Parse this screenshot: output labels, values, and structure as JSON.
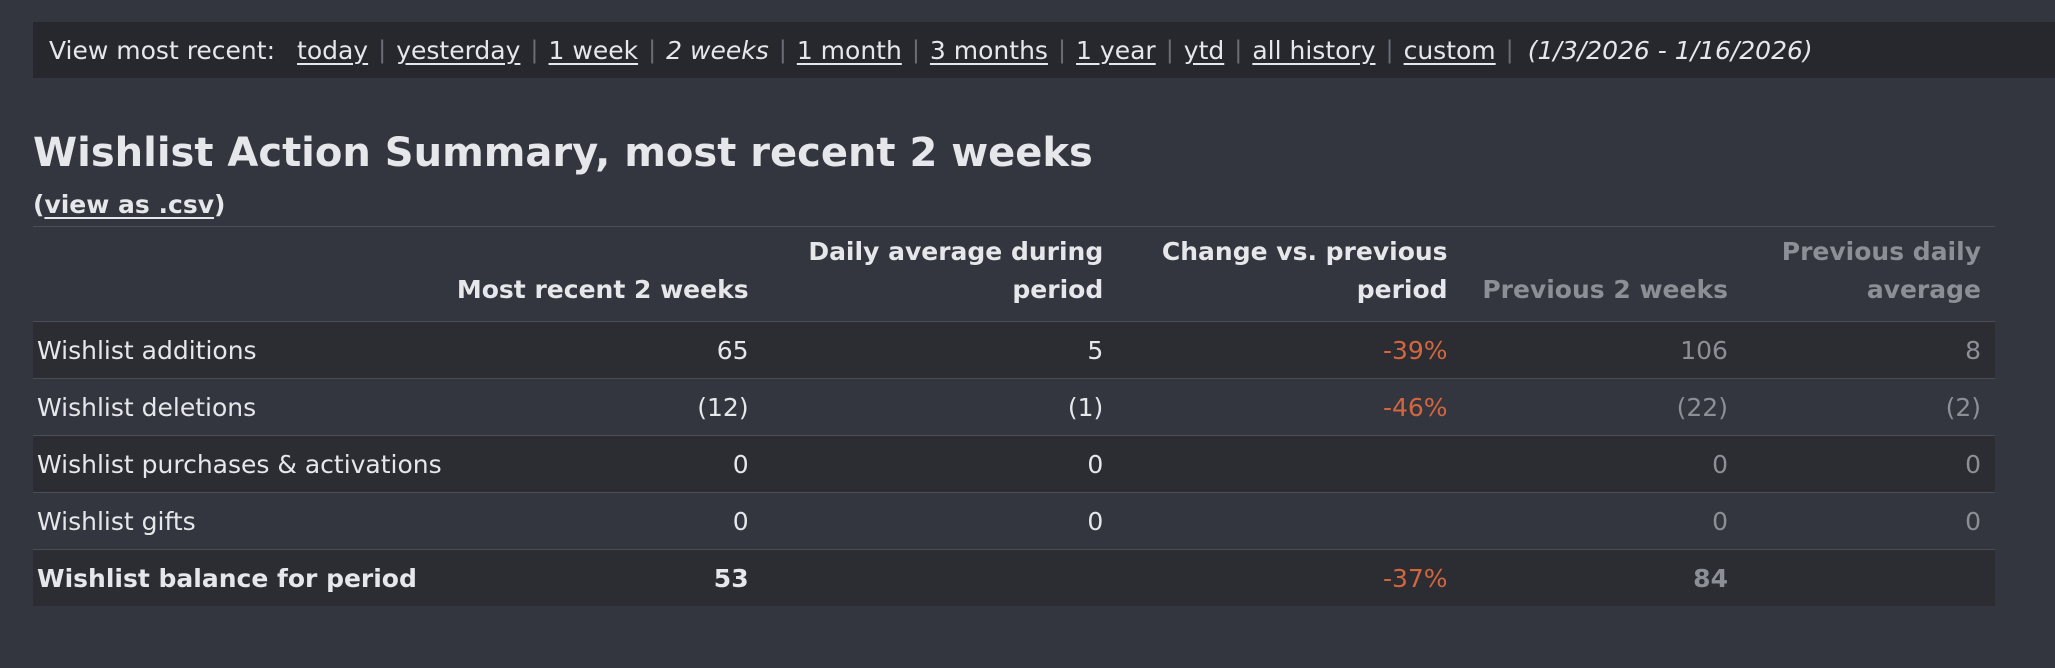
{
  "range_bar": {
    "prefix": "View most recent:",
    "options": [
      "today",
      "yesterday",
      "1 week",
      "2 weeks",
      "1 month",
      "3 months",
      "1 year",
      "ytd",
      "all history",
      "custom"
    ],
    "current": "2 weeks",
    "date_range": "(1/3/2026 - 1/16/2026)"
  },
  "summary": {
    "title": "Wishlist Action Summary, most recent 2 weeks",
    "csv_open": "(",
    "csv_link": "view as .csv",
    "csv_close": ")"
  },
  "table": {
    "headers": [
      "",
      "Most recent 2 weeks",
      "Daily average during period",
      "Change vs. previous period",
      "Previous 2 weeks",
      "Previous daily average"
    ],
    "rows": [
      {
        "label": "Wishlist additions",
        "recent": "65",
        "daily": "5",
        "change": "-39%",
        "prev": "106",
        "prev_daily": "8"
      },
      {
        "label": "Wishlist deletions",
        "recent": "(12)",
        "daily": "(1)",
        "change": "-46%",
        "prev": "(22)",
        "prev_daily": "(2)"
      },
      {
        "label": "Wishlist purchases & activations",
        "recent": "0",
        "daily": "0",
        "change": "",
        "prev": "0",
        "prev_daily": "0"
      },
      {
        "label": "Wishlist gifts",
        "recent": "0",
        "daily": "0",
        "change": "",
        "prev": "0",
        "prev_daily": "0"
      },
      {
        "label": "Wishlist balance for period",
        "recent": "53",
        "daily": "",
        "change": "-37%",
        "prev": "84",
        "prev_daily": ""
      }
    ]
  },
  "colors": {
    "background": "#33363e",
    "bar_background": "#26282d",
    "negative_change": "#d4663e",
    "previous_period_text": "#8c8f96"
  }
}
